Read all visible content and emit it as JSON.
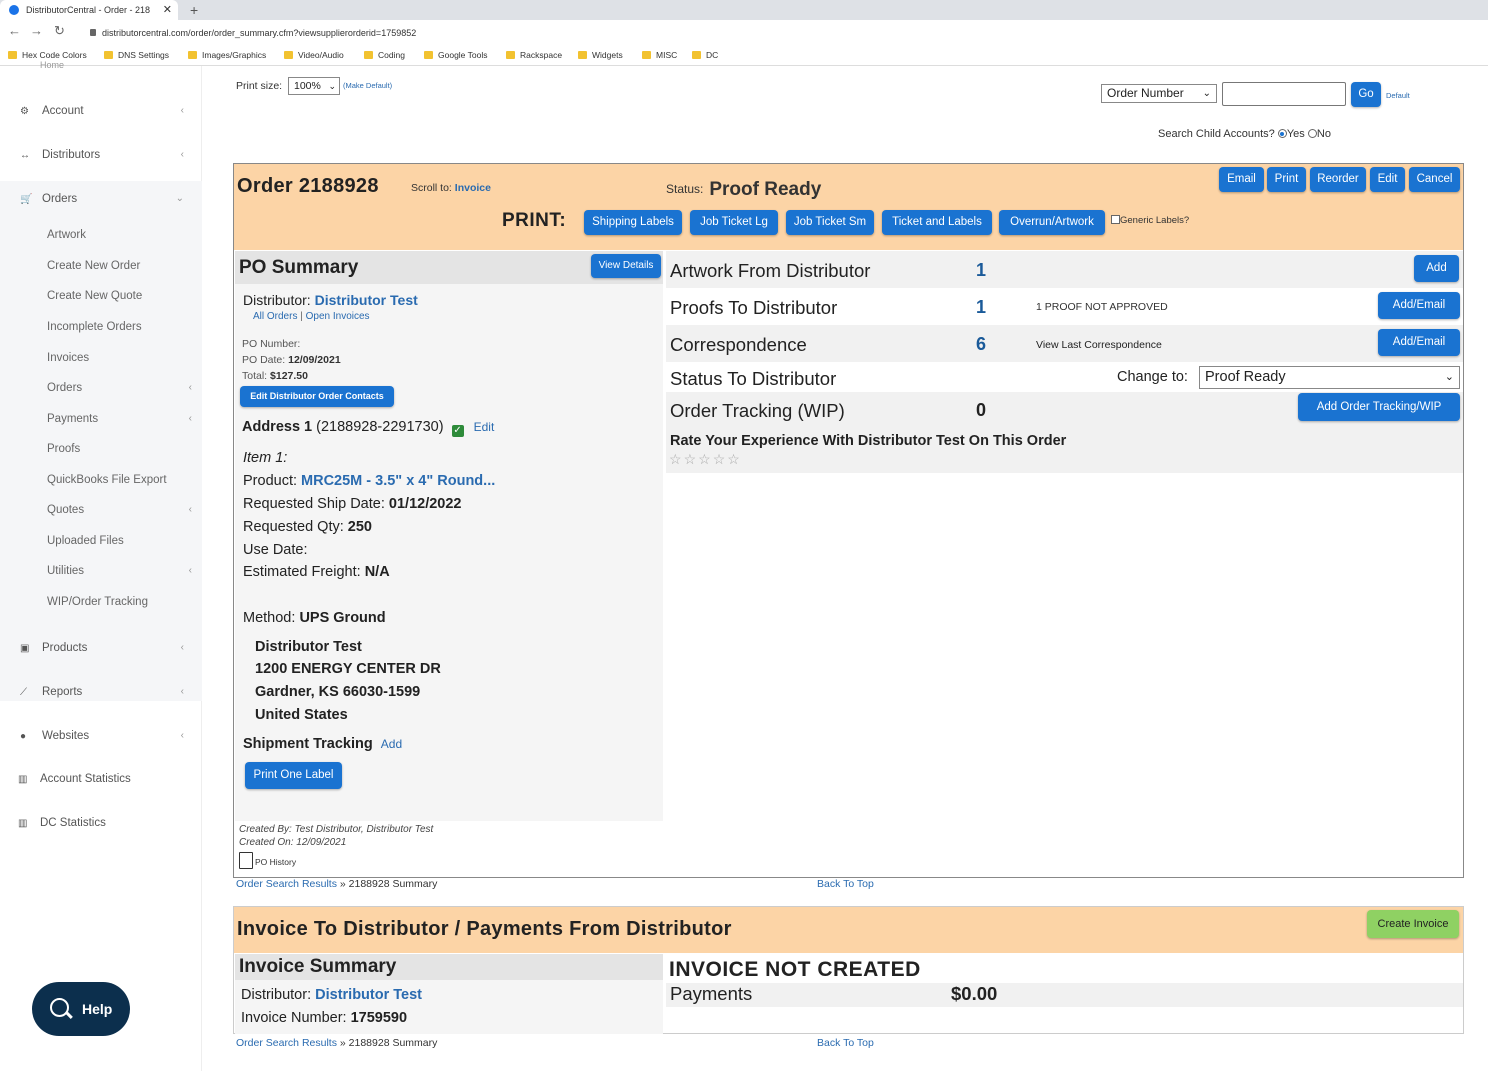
{
  "browser": {
    "tab_title": "DistributorCentral - Order - 218",
    "url": "distributorcentral.com/order/order_summary.cfm?viewsupplierorderid=1759852",
    "bookmarks": [
      "Hex Code Colors",
      "DNS Settings",
      "Images/Graphics",
      "Video/Audio",
      "Coding",
      "Google Tools",
      "Rackspace",
      "Widgets",
      "MISC",
      "DC"
    ]
  },
  "sidebar": {
    "top_partial": "Home",
    "items": [
      {
        "label": "Account",
        "icon": "gear-icon"
      },
      {
        "label": "Distributors",
        "icon": "arrows-icon"
      },
      {
        "label": "Orders",
        "icon": "cart-icon"
      },
      {
        "label": "Products",
        "icon": "box-icon"
      },
      {
        "label": "Reports",
        "icon": "chart-icon"
      },
      {
        "label": "Websites",
        "icon": "globe-icon"
      },
      {
        "label": "Account Statistics",
        "icon": "bar-chart-icon"
      },
      {
        "label": "DC Statistics",
        "icon": "bar-chart-icon"
      }
    ],
    "order_sub": [
      "Artwork",
      "Create New Order",
      "Create New Quote",
      "Incomplete Orders",
      "Invoices",
      "Orders",
      "Payments",
      "Proofs",
      "QuickBooks File Export",
      "Quotes",
      "Uploaded Files",
      "Utilities",
      "WIP/Order Tracking"
    ],
    "help_label": "Help"
  },
  "top": {
    "print_size_label": "Print size:",
    "print_size_value": "100%",
    "make_default": "(Make Default)",
    "search_type": "Order Number",
    "search_value": "",
    "go_label": "Go",
    "default_link": "Default",
    "child_accounts": "Search Child Accounts?",
    "yes": "Yes",
    "no": "No"
  },
  "order": {
    "title": "Order 2188928",
    "scroll_to_label": "Scroll to:",
    "scroll_to_link": "Invoice",
    "status_label": "Status:",
    "status_value": "Proof Ready",
    "actions": [
      "Email",
      "Print",
      "Reorder",
      "Edit",
      "Cancel"
    ],
    "print_label": "PRINT:",
    "print_buttons": [
      "Shipping Labels",
      "Job Ticket Lg",
      "Job Ticket Sm",
      "Ticket and Labels",
      "Overrun/Artwork"
    ],
    "generic_labels": "Generic Labels?"
  },
  "po_summary": {
    "title": "PO Summary",
    "view_details": "View Details",
    "distributor_label": "Distributor:",
    "distributor_name": "Distributor Test",
    "all_orders": "All Orders",
    "open_invoices": "Open Invoices",
    "po_number_label": "PO Number:",
    "po_date_label": "PO Date:",
    "po_date": "12/09/2021",
    "total_label": "Total:",
    "total": "$127.50",
    "edit_contacts": "Edit Distributor Order Contacts",
    "address_label": "Address 1",
    "address_id": "(2188928-2291730)",
    "edit": "Edit",
    "item_label": "Item 1:",
    "product_label": "Product:",
    "product": "MRC25M - 3.5\" x 4\" Round...",
    "ship_date_label": "Requested Ship Date:",
    "ship_date": "01/12/2022",
    "qty_label": "Requested Qty:",
    "qty": "250",
    "use_date_label": "Use Date:",
    "freight_label": "Estimated Freight:",
    "freight": "N/A",
    "method_label": "Method:",
    "method": "UPS Ground",
    "ship_name": "Distributor Test",
    "ship_street": "1200 ENERGY CENTER DR",
    "ship_city": "Gardner, KS 66030-1599",
    "ship_country": "United States",
    "tracking_label": "Shipment Tracking",
    "tracking_add": "Add",
    "print_one_label": "Print One Label",
    "created_by": "Created By: Test Distributor, Distributor Test",
    "created_on": "Created On: 12/09/2021",
    "po_history": "PO History"
  },
  "rows": {
    "artwork": {
      "label": "Artwork From Distributor",
      "count": "1",
      "button": "Add"
    },
    "proofs": {
      "label": "Proofs To Distributor",
      "count": "1",
      "note": "1 PROOF NOT APPROVED",
      "button": "Add/Email"
    },
    "corr": {
      "label": "Correspondence",
      "count": "6",
      "note": "View Last Correspondence",
      "button": "Add/Email"
    },
    "status": {
      "label": "Status To Distributor",
      "change_label": "Change to:",
      "value": "Proof Ready"
    },
    "tracking": {
      "label": "Order Tracking (WIP)",
      "count": "0",
      "button": "Add Order Tracking/WIP"
    },
    "rate": "Rate Your Experience With Distributor Test On This Order",
    "stars": [
      "☆",
      "☆",
      "☆",
      "☆",
      "☆"
    ]
  },
  "breadcrumb": {
    "link": "Order Search Results",
    "sep": "»",
    "current": "2188928 Summary",
    "back_to_top": "Back To Top"
  },
  "invoice": {
    "title": "Invoice To Distributor / Payments From Distributor",
    "create": "Create Invoice",
    "summary_title": "Invoice Summary",
    "distributor_label": "Distributor:",
    "distributor_name": "Distributor Test",
    "number_label": "Invoice Number:",
    "number": "1759590",
    "not_created": "INVOICE NOT CREATED",
    "payments_label": "Payments",
    "payments_value": "$0.00"
  },
  "colors": {
    "accent": "#1a73d1",
    "header_band": "#fcd4a6",
    "link": "#2a6bb0",
    "create_btn": "#8fd163"
  }
}
